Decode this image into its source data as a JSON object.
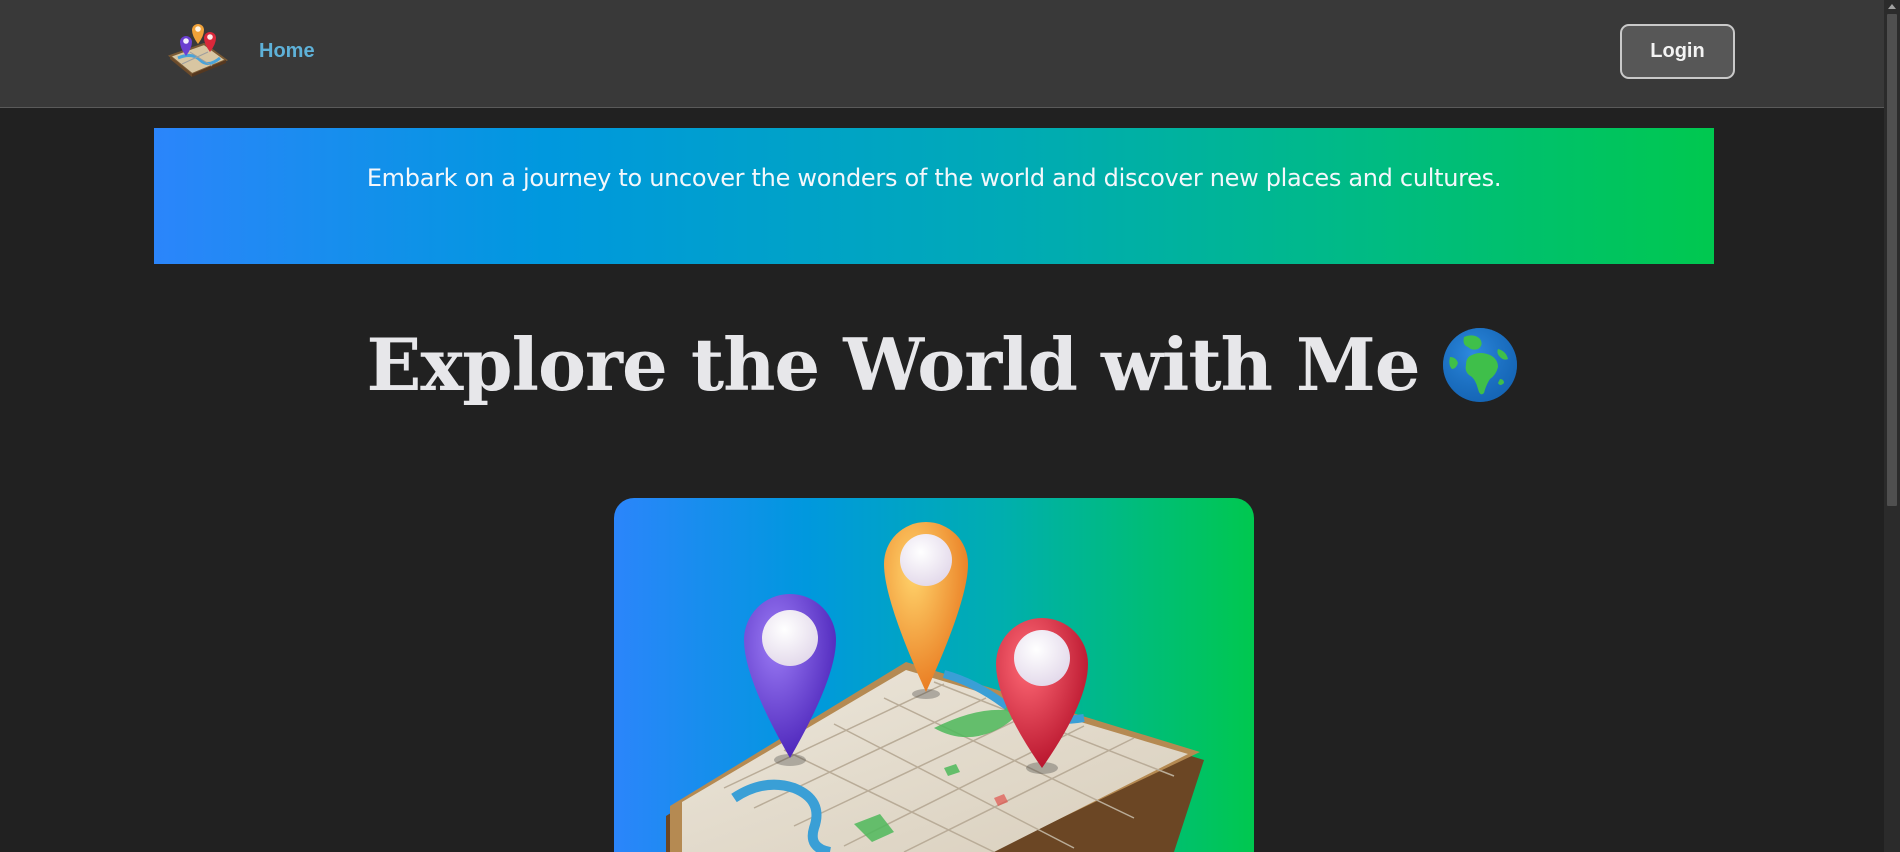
{
  "navbar": {
    "logo_icon": "map-pins-logo-icon",
    "home_label": "Home",
    "login_label": "Login"
  },
  "banner": {
    "text": "Embark on a journey to uncover the wonders of the world and discover new places and cultures."
  },
  "hero": {
    "title": "Explore the World with Me",
    "title_icon": "globe-africa-icon",
    "image_icon": "map-with-location-pins-illustration"
  },
  "colors": {
    "background": "#212121",
    "navbar": "#393939",
    "link": "#5eb1d8",
    "gradient_start": "#2b85fb",
    "gradient_end": "#00c84f",
    "heading": "#e7e7ea"
  }
}
